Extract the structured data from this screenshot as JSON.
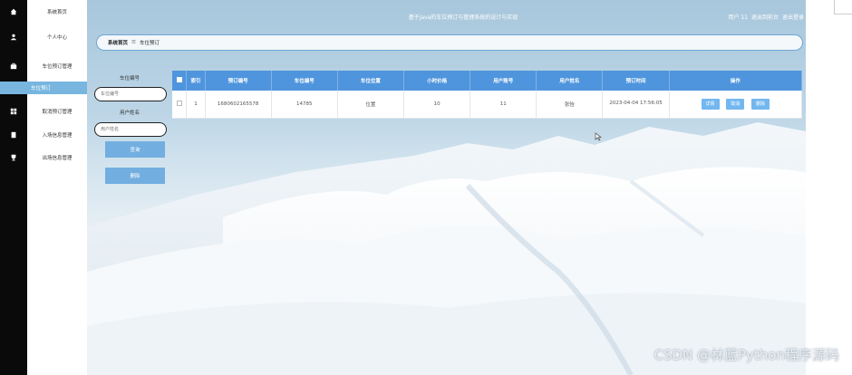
{
  "app": {
    "title": "基于java的车位预订与管理系统的设计与实现",
    "user_label": "用户 11",
    "exit_portal": "退出到前台",
    "logout": "退出登录"
  },
  "sidebar": {
    "items": [
      {
        "icon": "home-icon",
        "label": "系统首页"
      },
      {
        "icon": "user-icon",
        "label": "个人中心"
      },
      {
        "icon": "briefcase-icon",
        "label": "车位预订管理"
      },
      {
        "label": "车位预订",
        "sub": true
      },
      {
        "icon": "grid-icon",
        "label": "取消预订管理"
      },
      {
        "icon": "document-icon",
        "label": "入场信息管理"
      },
      {
        "icon": "trophy-icon",
        "label": "出场信息管理"
      }
    ]
  },
  "breadcrumb": {
    "home": "系统首页",
    "sep": "☰",
    "current": "车位预订"
  },
  "search": {
    "field1_label": "车位编号",
    "field1_placeholder": "车位编号",
    "field2_label": "用户姓名",
    "field2_placeholder": "用户姓名",
    "query_button": "查询",
    "delete_button": "删除"
  },
  "table": {
    "columns": [
      "",
      "索引",
      "预订编号",
      "车位编号",
      "车位位置",
      "小时价格",
      "用户账号",
      "用户姓名",
      "预订时间",
      "操作"
    ],
    "rows": [
      {
        "index": "1",
        "booking_no": "1680602165578",
        "space_no": "14785",
        "location": "位置",
        "hourly_price": "10",
        "user_account": "11",
        "user_name": "张怡",
        "booking_time": "2023-04-04 17:56:05",
        "actions": [
          "详情",
          "取消",
          "删除"
        ]
      }
    ]
  },
  "watermark": "CSDN @林蓝Python程序源码"
}
